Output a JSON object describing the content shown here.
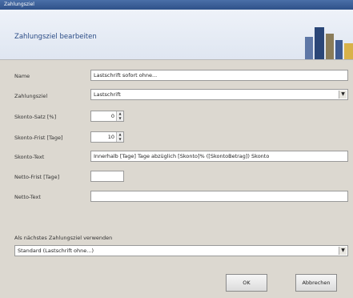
{
  "window": {
    "title": "Zahlungsziel"
  },
  "header": {
    "title": "Zahlungsziel bearbeiten"
  },
  "form": {
    "name_label": "Name",
    "name_value": "Lastschrift sofort ohne...",
    "type_label": "Zahlungsziel",
    "type_value": "Lastschrift",
    "discount_label": "Skonto-Satz [%]",
    "discount_value": "0",
    "discount_days_label": "Skonto-Frist [Tage]",
    "discount_days_value": "10",
    "discount_text_label": "Skonto-Text",
    "discount_text_value": "Innerhalb [Tage] Tage abzüglich [Skonto]% ([SkontoBetrag]) Skonto",
    "net_days_label": "Netto-Frist [Tage]",
    "net_days_value": "",
    "net_text_label": "Netto-Text",
    "net_text_value": "",
    "other_label": "Als nächstes Zahlungsziel verwenden",
    "other_value": "Standard (Lastschrift ohne...)"
  },
  "buttons": {
    "ok": "OK",
    "cancel": "Abbrechen"
  }
}
